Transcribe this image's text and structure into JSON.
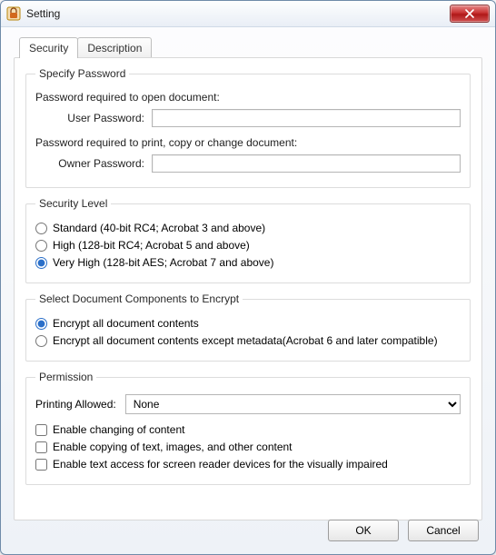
{
  "window": {
    "title": "Setting"
  },
  "tabs": {
    "security": "Security",
    "description": "Description",
    "active": "security"
  },
  "specify": {
    "legend": "Specify Password",
    "open_label": "Password required to open document:",
    "user_label": "User Password:",
    "user_value": "",
    "change_label": "Password required to print, copy or change document:",
    "owner_label": "Owner Password:",
    "owner_value": ""
  },
  "level": {
    "legend": "Security Level",
    "standard": "Standard (40-bit RC4; Acrobat 3 and above)",
    "high": "High (128-bit RC4; Acrobat 5 and above)",
    "veryhigh": "Very High (128-bit AES; Acrobat 7 and above)",
    "selected": "veryhigh"
  },
  "encrypt": {
    "legend": "Select Document Components to Encrypt",
    "all": "Encrypt all document contents",
    "except": "Encrypt all document contents except metadata(Acrobat 6 and later compatible)",
    "selected": "all"
  },
  "permission": {
    "legend": "Permission",
    "printing_label": "Printing Allowed:",
    "printing_value": "None",
    "printing_options": [
      "None"
    ],
    "enable_change": "Enable changing of content",
    "enable_copy": "Enable copying of text, images, and other content",
    "enable_access": "Enable text access for screen reader devices for the visually impaired",
    "change_checked": false,
    "copy_checked": false,
    "access_checked": false
  },
  "buttons": {
    "ok": "OK",
    "cancel": "Cancel"
  }
}
